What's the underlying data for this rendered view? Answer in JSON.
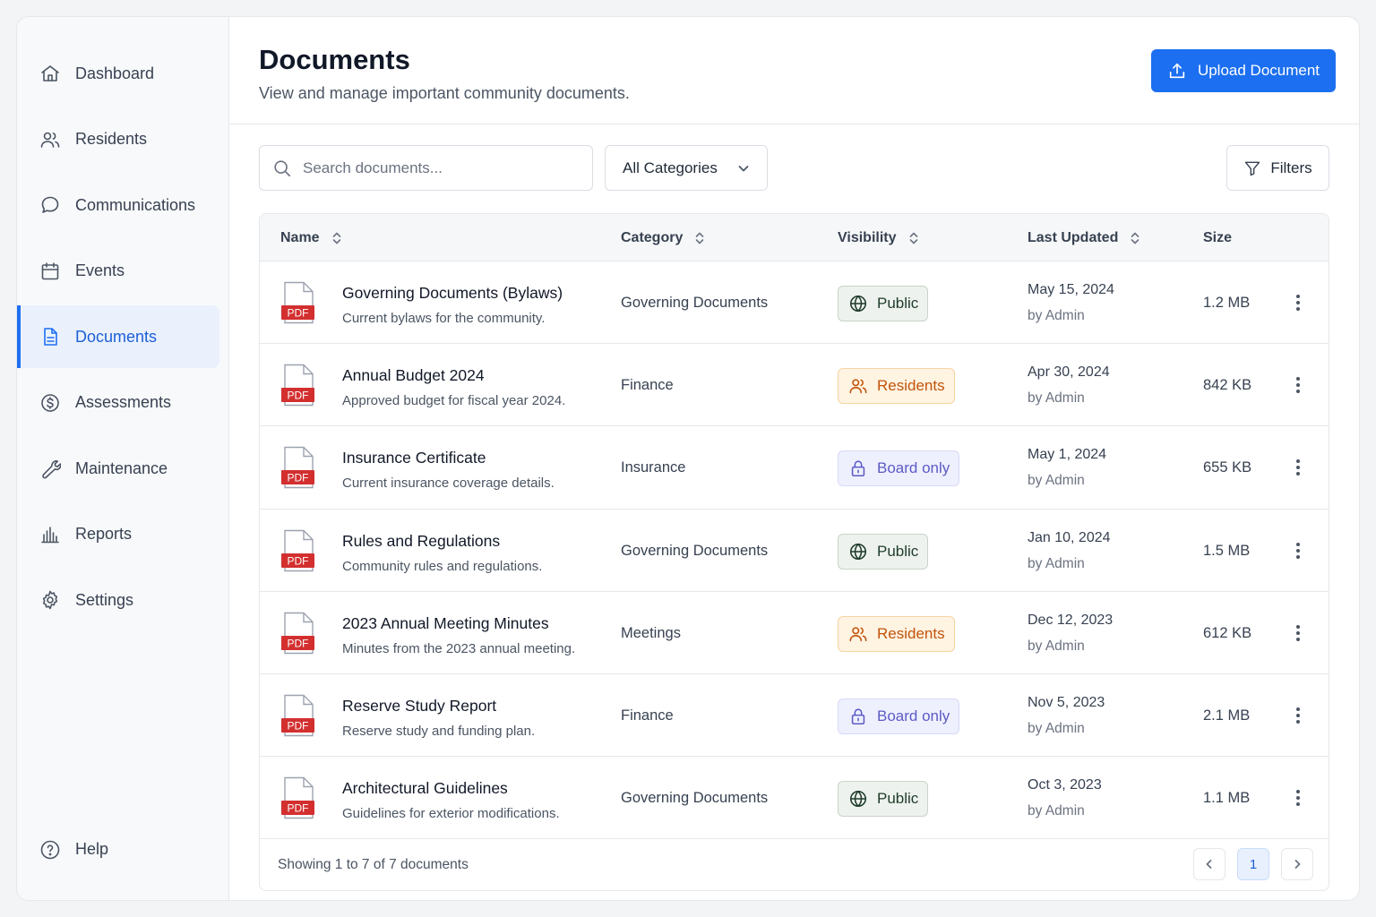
{
  "sidebar": {
    "items": [
      {
        "label": "Dashboard",
        "icon": "home-icon"
      },
      {
        "label": "Residents",
        "icon": "users-icon"
      },
      {
        "label": "Communications",
        "icon": "chat-bubble-icon"
      },
      {
        "label": "Events",
        "icon": "calendar-icon"
      },
      {
        "label": "Documents",
        "icon": "document-icon",
        "active": true
      },
      {
        "label": "Assessments",
        "icon": "dollar-circle-icon"
      },
      {
        "label": "Maintenance",
        "icon": "wrench-icon"
      },
      {
        "label": "Reports",
        "icon": "bar-chart-icon"
      },
      {
        "label": "Settings",
        "icon": "gear-icon"
      }
    ],
    "help": {
      "label": "Help",
      "icon": "help-circle-icon"
    }
  },
  "header": {
    "title": "Documents",
    "subtitle": "View and manage important community documents.",
    "upload_label": "Upload Document"
  },
  "toolbar": {
    "search_placeholder": "Search documents...",
    "category_selected": "All Categories",
    "filters_label": "Filters"
  },
  "table": {
    "columns": {
      "name": "Name",
      "category": "Category",
      "visibility": "Visibility",
      "last_updated": "Last Updated",
      "size": "Size"
    },
    "file_badge": "PDF",
    "rows": [
      {
        "name": "Governing Documents (Bylaws)",
        "desc": "Current bylaws for the community.",
        "category": "Governing Documents",
        "visibility": "Public",
        "vis_type": "public",
        "date": "May 15, 2024",
        "by": "by Admin",
        "size": "1.2 MB"
      },
      {
        "name": "Annual Budget 2024",
        "desc": "Approved budget for fiscal year 2024.",
        "category": "Finance",
        "visibility": "Residents",
        "vis_type": "residents",
        "date": "Apr 30, 2024",
        "by": "by Admin",
        "size": "842 KB"
      },
      {
        "name": "Insurance Certificate",
        "desc": "Current insurance coverage details.",
        "category": "Insurance",
        "visibility": "Board only",
        "vis_type": "board",
        "date": "May 1, 2024",
        "by": "by Admin",
        "size": "655 KB"
      },
      {
        "name": "Rules and Regulations",
        "desc": "Community rules and regulations.",
        "category": "Governing Documents",
        "visibility": "Public",
        "vis_type": "public",
        "date": "Jan 10, 2024",
        "by": "by Admin",
        "size": "1.5 MB"
      },
      {
        "name": "2023 Annual Meeting Minutes",
        "desc": "Minutes from the 2023 annual meeting.",
        "category": "Meetings",
        "visibility": "Residents",
        "vis_type": "residents",
        "date": "Dec 12, 2023",
        "by": "by Admin",
        "size": "612 KB"
      },
      {
        "name": "Reserve Study Report",
        "desc": "Reserve study and funding plan.",
        "category": "Finance",
        "visibility": "Board only",
        "vis_type": "board",
        "date": "Nov 5, 2023",
        "by": "by Admin",
        "size": "2.1 MB"
      },
      {
        "name": "Architectural Guidelines",
        "desc": "Guidelines for exterior modifications.",
        "category": "Governing Documents",
        "visibility": "Public",
        "vis_type": "public",
        "date": "Oct 3, 2023",
        "by": "by Admin",
        "size": "1.1 MB"
      }
    ]
  },
  "footer": {
    "showing": "Showing 1 to 7 of 7 documents",
    "current_page": "1"
  },
  "colors": {
    "accent": "#1c6ff0",
    "pdf_red": "#d32f2f",
    "public": "#1e3b2a",
    "residents": "#c2540a",
    "board": "#5b5bc7"
  }
}
